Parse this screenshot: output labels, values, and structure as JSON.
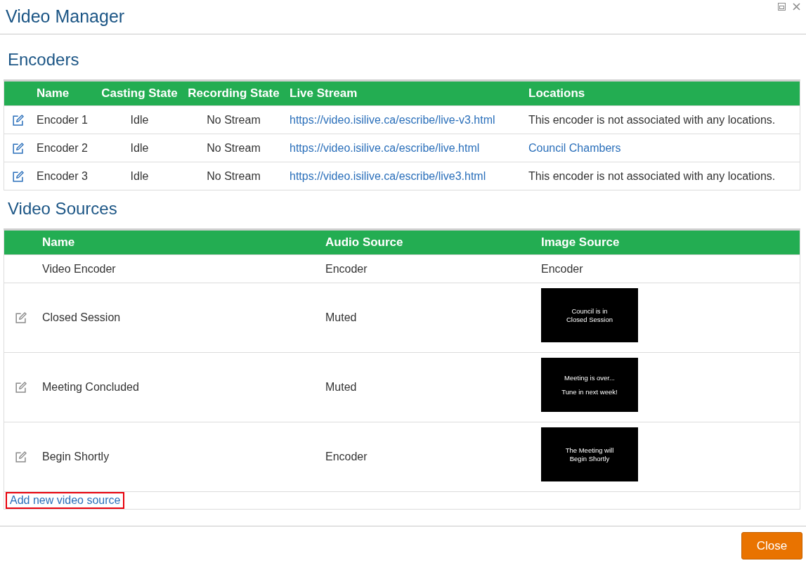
{
  "window": {
    "title": "Video Manager"
  },
  "encoders": {
    "heading": "Encoders",
    "columns": [
      "Name",
      "Casting State",
      "Recording State",
      "Live Stream",
      "Locations"
    ],
    "rows": [
      {
        "name": "Encoder 1",
        "casting_state": "Idle",
        "recording_state": "No Stream",
        "live_stream": "https://video.isilive.ca/escribe/live-v3.html",
        "location": {
          "kind": "text",
          "text": "This encoder is not associated with any locations."
        }
      },
      {
        "name": "Encoder 2",
        "casting_state": "Idle",
        "recording_state": "No Stream",
        "live_stream": "https://video.isilive.ca/escribe/live.html",
        "location": {
          "kind": "link",
          "text": "Council Chambers"
        }
      },
      {
        "name": "Encoder 3",
        "casting_state": "Idle",
        "recording_state": "No Stream",
        "live_stream": "https://video.isilive.ca/escribe/live3.html",
        "location": {
          "kind": "text",
          "text": "This encoder is not associated with any locations."
        }
      }
    ]
  },
  "video_sources": {
    "heading": "Video Sources",
    "columns": [
      "Name",
      "Audio Source",
      "Image Source"
    ],
    "rows": [
      {
        "name": "Video Encoder",
        "editable": false,
        "audio_source": "Encoder",
        "image_source": {
          "kind": "text",
          "text": "Encoder"
        }
      },
      {
        "name": "Closed Session",
        "editable": true,
        "audio_source": "Muted",
        "image_source": {
          "kind": "image",
          "paragraphs": [
            [
              "Council is in",
              "Closed Session"
            ]
          ]
        }
      },
      {
        "name": "Meeting Concluded",
        "editable": true,
        "audio_source": "Muted",
        "image_source": {
          "kind": "image",
          "paragraphs": [
            [
              "Meeting is over..."
            ],
            [
              "Tune in next week!"
            ]
          ]
        }
      },
      {
        "name": "Begin Shortly",
        "editable": true,
        "audio_source": "Encoder",
        "image_source": {
          "kind": "image",
          "paragraphs": [
            [
              "The Meeting will",
              "Begin Shortly"
            ]
          ]
        }
      }
    ],
    "add_link": {
      "label": "Add new video source",
      "highlighted": true
    }
  },
  "buttons": [
    {
      "label": "Close",
      "kind": "primary"
    }
  ]
}
